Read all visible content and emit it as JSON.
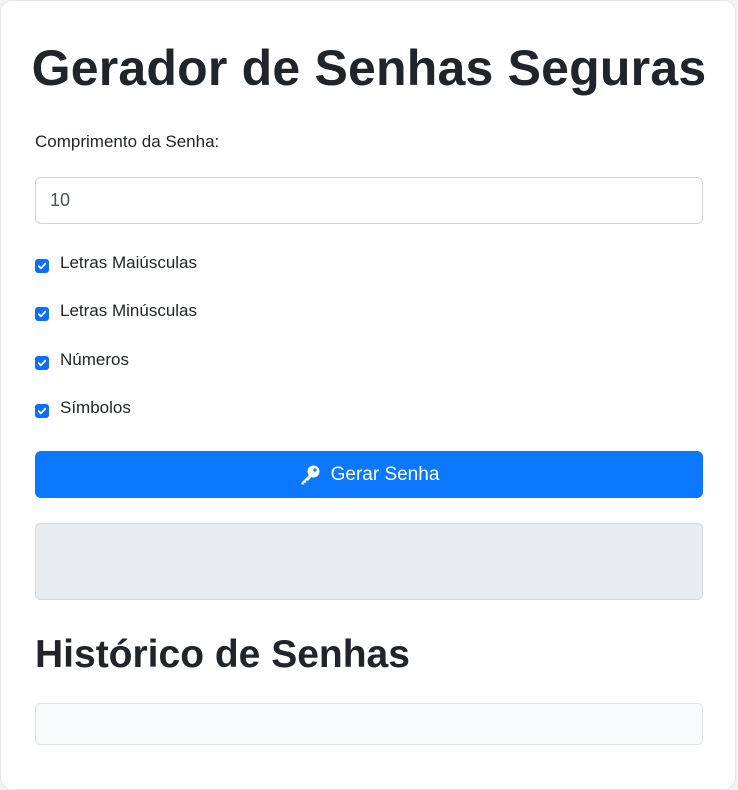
{
  "header": {
    "title": "Gerador de Senhas Seguras"
  },
  "form": {
    "length_label": "Comprimento da Senha:",
    "length_value": "10",
    "options": [
      {
        "label": "Letras Maiúsculas",
        "checked": true
      },
      {
        "label": "Letras Minúsculas",
        "checked": true
      },
      {
        "label": "Números",
        "checked": true
      },
      {
        "label": "Símbolos",
        "checked": true
      }
    ],
    "generate_label": "Gerar Senha",
    "generate_icon": "key-icon"
  },
  "result": {
    "password": ""
  },
  "history": {
    "title": "Histórico de Senhas",
    "items": []
  },
  "colors": {
    "accent": "#0b78ff",
    "checkbox": "#0d6efd",
    "result_bg": "#e9ecef"
  }
}
